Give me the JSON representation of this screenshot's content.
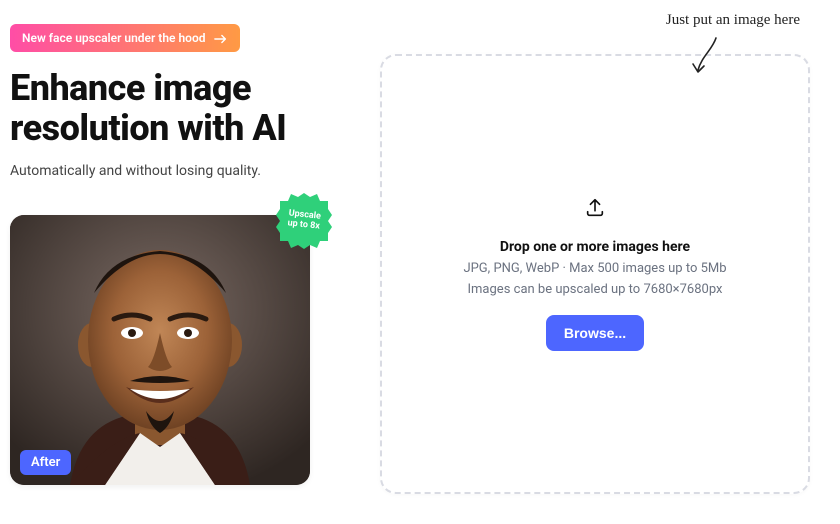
{
  "promo": {
    "label": "New face upscaler under the hood"
  },
  "hero": {
    "title": "Enhance image resolution with AI",
    "subtitle": "Automatically and without losing quality."
  },
  "sticker": {
    "text": "Upscale\nup to 8x"
  },
  "after_chip": "After",
  "handwriting": "Just put an image here",
  "dropzone": {
    "title": "Drop one or more images here",
    "line1": "JPG, PNG, WebP · Max 500 images up to 5Mb",
    "line2": "Images can be upscaled up to 7680×7680px",
    "browse": "Browse..."
  },
  "colors": {
    "primary": "#4d66ff",
    "green": "#2fd07a"
  }
}
